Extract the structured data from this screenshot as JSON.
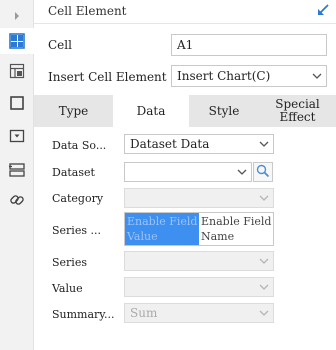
{
  "panel": {
    "title": "Cell Element"
  },
  "cell": {
    "label": "Cell",
    "value": "A1"
  },
  "insert": {
    "label": "Insert Cell Element",
    "value": "Insert Chart(C)"
  },
  "tabs": [
    {
      "label": "Type",
      "active": false
    },
    {
      "label": "Data",
      "active": true
    },
    {
      "label": "Style",
      "active": false
    },
    {
      "label": "Special Effect",
      "active": false
    }
  ],
  "data_tab": {
    "data_source_label": "Data So...",
    "data_source_value": "Dataset Data",
    "dataset_label": "Dataset",
    "dataset_value": "",
    "category_label": "Category",
    "series_name_label": "Series ...",
    "series_name_left": "Enable Field Value",
    "series_name_right": "Enable Field Name",
    "series_label": "Series",
    "value_label": "Value",
    "summary_label": "Summary...",
    "summary_value": "Sum"
  },
  "colors": {
    "accent": "#2b7ad3",
    "selection": "#3d8ff0"
  },
  "icons": {
    "rail": [
      "expand-arrow-icon",
      "cell-element-icon",
      "cell-attribute-icon",
      "border-icon",
      "widget-icon",
      "condition-icon",
      "hyperlink-icon"
    ],
    "pin": "pin-icon"
  }
}
